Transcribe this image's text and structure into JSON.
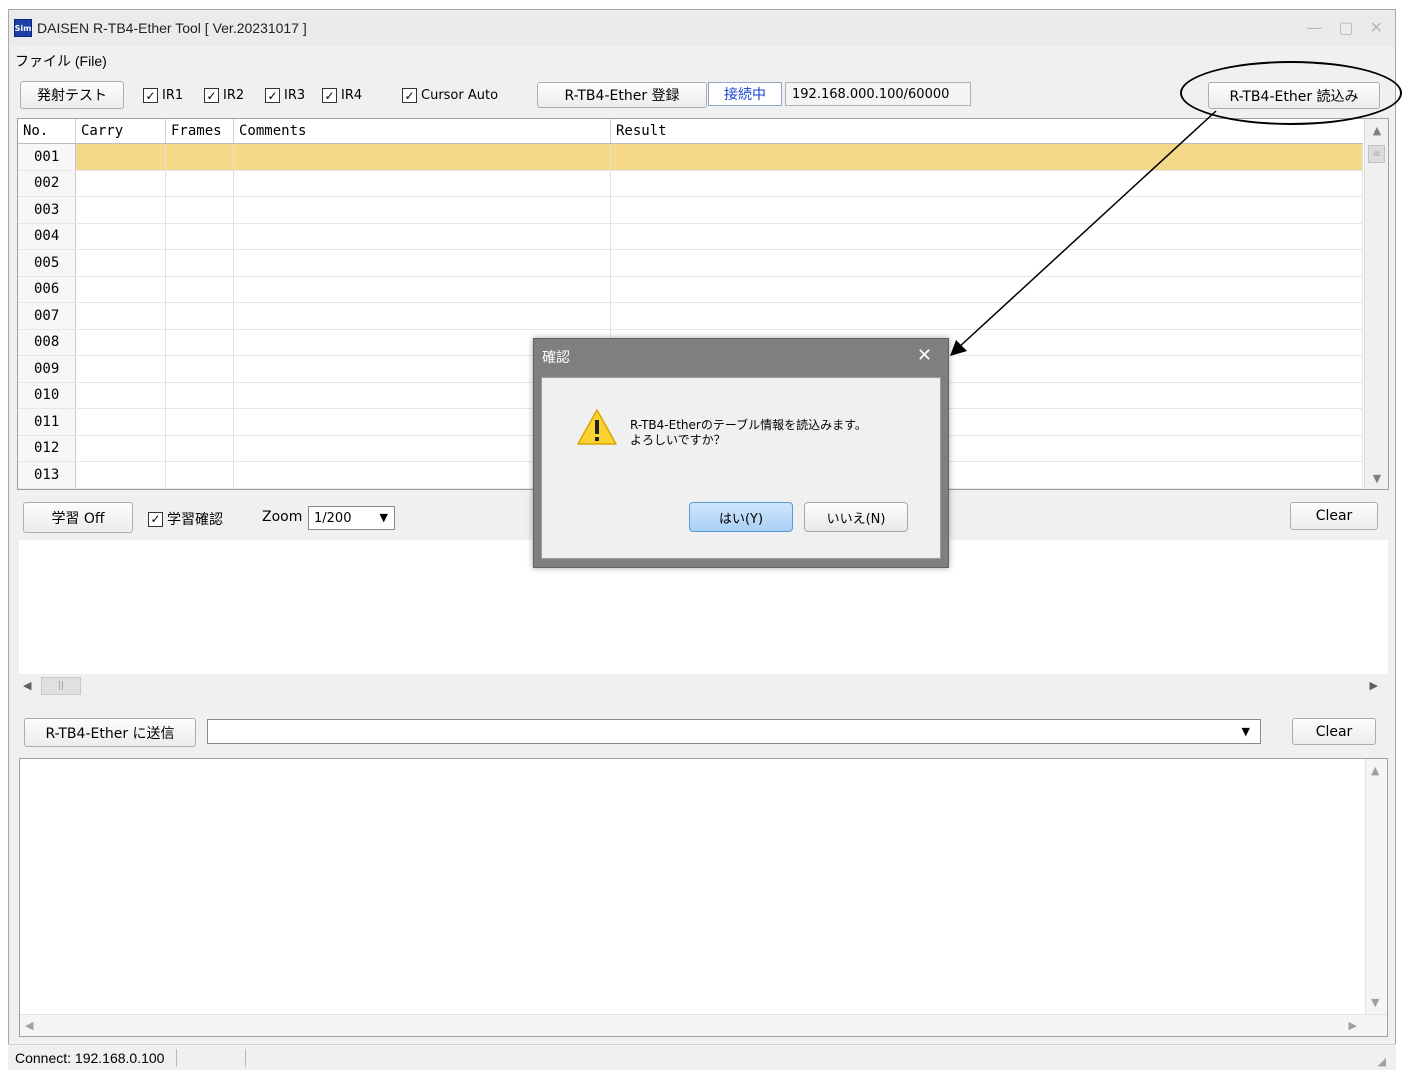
{
  "window": {
    "title": "DAISEN R-TB4-Ether Tool  [ Ver.20231017 ]",
    "icon_label": "Sim",
    "controls": [
      "—",
      "▢",
      "✕"
    ]
  },
  "menu": {
    "file": "ファイル (File)"
  },
  "toolbar": {
    "fire_test": "発射テスト",
    "ir1": "IR1",
    "ir2": "IR2",
    "ir3": "IR3",
    "ir4": "IR4",
    "cursor_auto": "Cursor Auto",
    "register": "R-TB4-Ether 登録",
    "connection_status": "接続中",
    "ip_address": "192.168.000.100/60000",
    "read": "R-TB4-Ether 読込み"
  },
  "grid": {
    "columns": [
      "No.",
      "Carry",
      "Frames",
      "Comments",
      "Result"
    ],
    "rows": [
      "001",
      "002",
      "003",
      "004",
      "005",
      "006",
      "007",
      "008",
      "009",
      "010",
      "011",
      "012",
      "013"
    ],
    "selected_row": "001",
    "selected_color": "#f5d98b"
  },
  "learn": {
    "learn_off": "学習 Off",
    "learn_confirm": "学習確認",
    "zoom_label": "Zoom",
    "zoom_value": "1/200",
    "clear": "Clear"
  },
  "send": {
    "send_button": "R-TB4-Ether に送信",
    "clear": "Clear"
  },
  "status": {
    "connect": "Connect: 192.168.0.100"
  },
  "dialog": {
    "title": "確認",
    "message": "R-TB4-Etherのテーブル情報を読込みます。\nよろしいですか？",
    "yes": "はい(Y)",
    "no": "いいえ(N)",
    "icon": "warning-icon"
  }
}
